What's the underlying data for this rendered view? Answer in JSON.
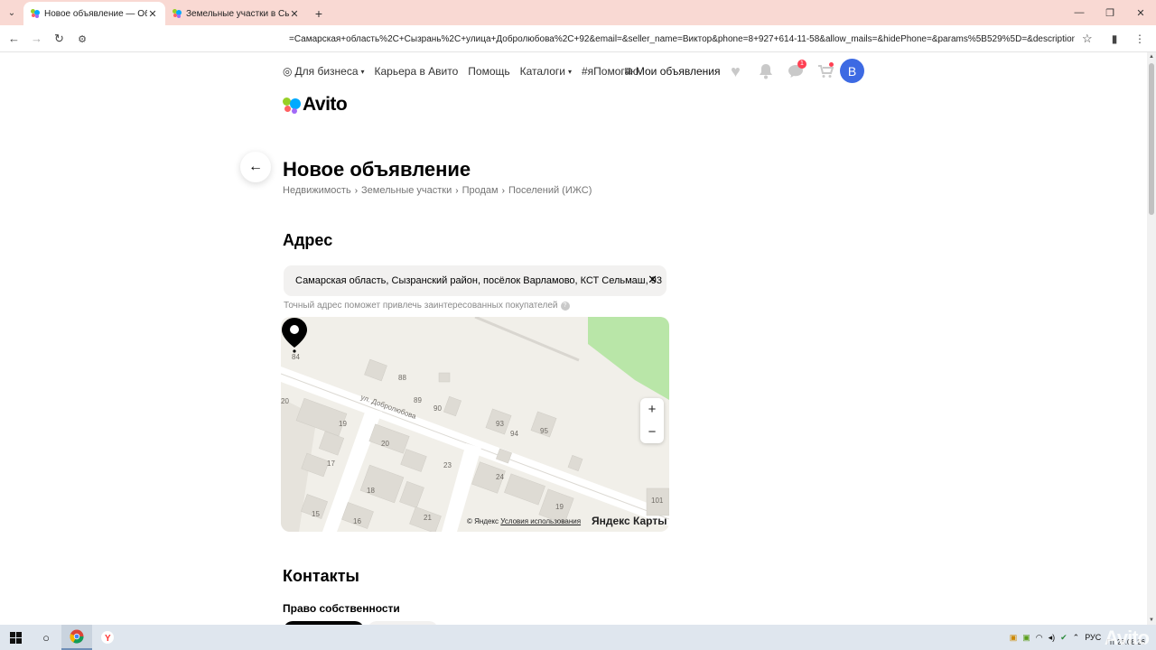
{
  "browser": {
    "tabs": [
      {
        "title": "Новое объявление — Объявл",
        "active": true
      },
      {
        "title": "Земельные участки в Сызрани",
        "active": false
      }
    ],
    "url": "=Самарская+область%2C+Сызрань%2C+улица+Добролюбова%2C+92&email=&seller_name=Виктор&phone=8+927+614-11-58&allow_mails=&hidePhone=&params%5B529%5D=&description=&price=&..."
  },
  "header": {
    "nav": [
      {
        "label": "Для бизнеса",
        "icon": "business-icon",
        "dropdown": true
      },
      {
        "label": "Карьера в Авито",
        "dropdown": false
      },
      {
        "label": "Помощь",
        "dropdown": false
      },
      {
        "label": "Каталоги",
        "dropdown": true
      },
      {
        "label": "#яПомогаю",
        "dropdown": false
      }
    ],
    "my_ads": "Мои объявления",
    "messages_badge": "1",
    "avatar_letter": "В",
    "logo_text": "Avito"
  },
  "page": {
    "title": "Новое объявление",
    "breadcrumbs": [
      "Недвижимость",
      "Земельные участки",
      "Продам",
      "Поселений (ИЖС)"
    ]
  },
  "address": {
    "heading": "Адрес",
    "value": "Самарская область, Сызранский район, посёлок Варламово, КСТ Сельмаш, 93",
    "hint": "Точный адрес поможет привлечь заинтересованных покупателей"
  },
  "map": {
    "street_label": "ул. Добролюбова",
    "house_numbers": [
      "84",
      "88",
      "89",
      "90",
      "93",
      "94",
      "95",
      "20",
      "19",
      "17",
      "20",
      "23",
      "24",
      "18",
      "16",
      "15",
      "21",
      "19",
      "101"
    ],
    "copyright": "© Яндекс",
    "terms_link": "Условия использования",
    "brand": "Яндекс Карты",
    "zoom_in": "+",
    "zoom_out": "−"
  },
  "contacts": {
    "heading": "Контакты",
    "ownership_label": "Право собственности"
  },
  "taskbar": {
    "lang": "РУС",
    "clock_day": "Пт 28.08.26",
    "watermark": "Avito"
  },
  "colors": {
    "tab_strip": "#f9d9d3",
    "avatar": "#3d6ae3",
    "badge": "#ff4053",
    "field_bg": "#f2f1f0"
  }
}
